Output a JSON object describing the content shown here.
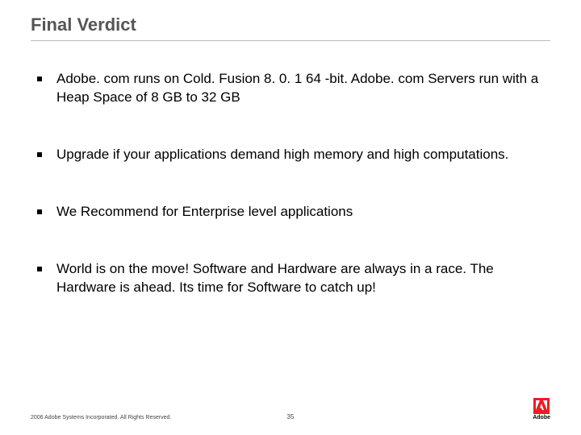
{
  "title": "Final Verdict",
  "bullets": [
    "Adobe. com runs on Cold. Fusion 8. 0. 1 64 -bit.  Adobe. com Servers run with a Heap Space of 8 GB to 32 GB",
    "Upgrade if your applications demand high memory and high computations.",
    "We Recommend for Enterprise level applications",
    "World is on the move! Software and Hardware  are  always in a race. The Hardware is ahead.  Its time for Software to catch up!"
  ],
  "footer": {
    "copyright": "2006 Adobe Systems Incorporated. All Rights Reserved.",
    "page_number": "35",
    "logo_text": "Adobe"
  }
}
